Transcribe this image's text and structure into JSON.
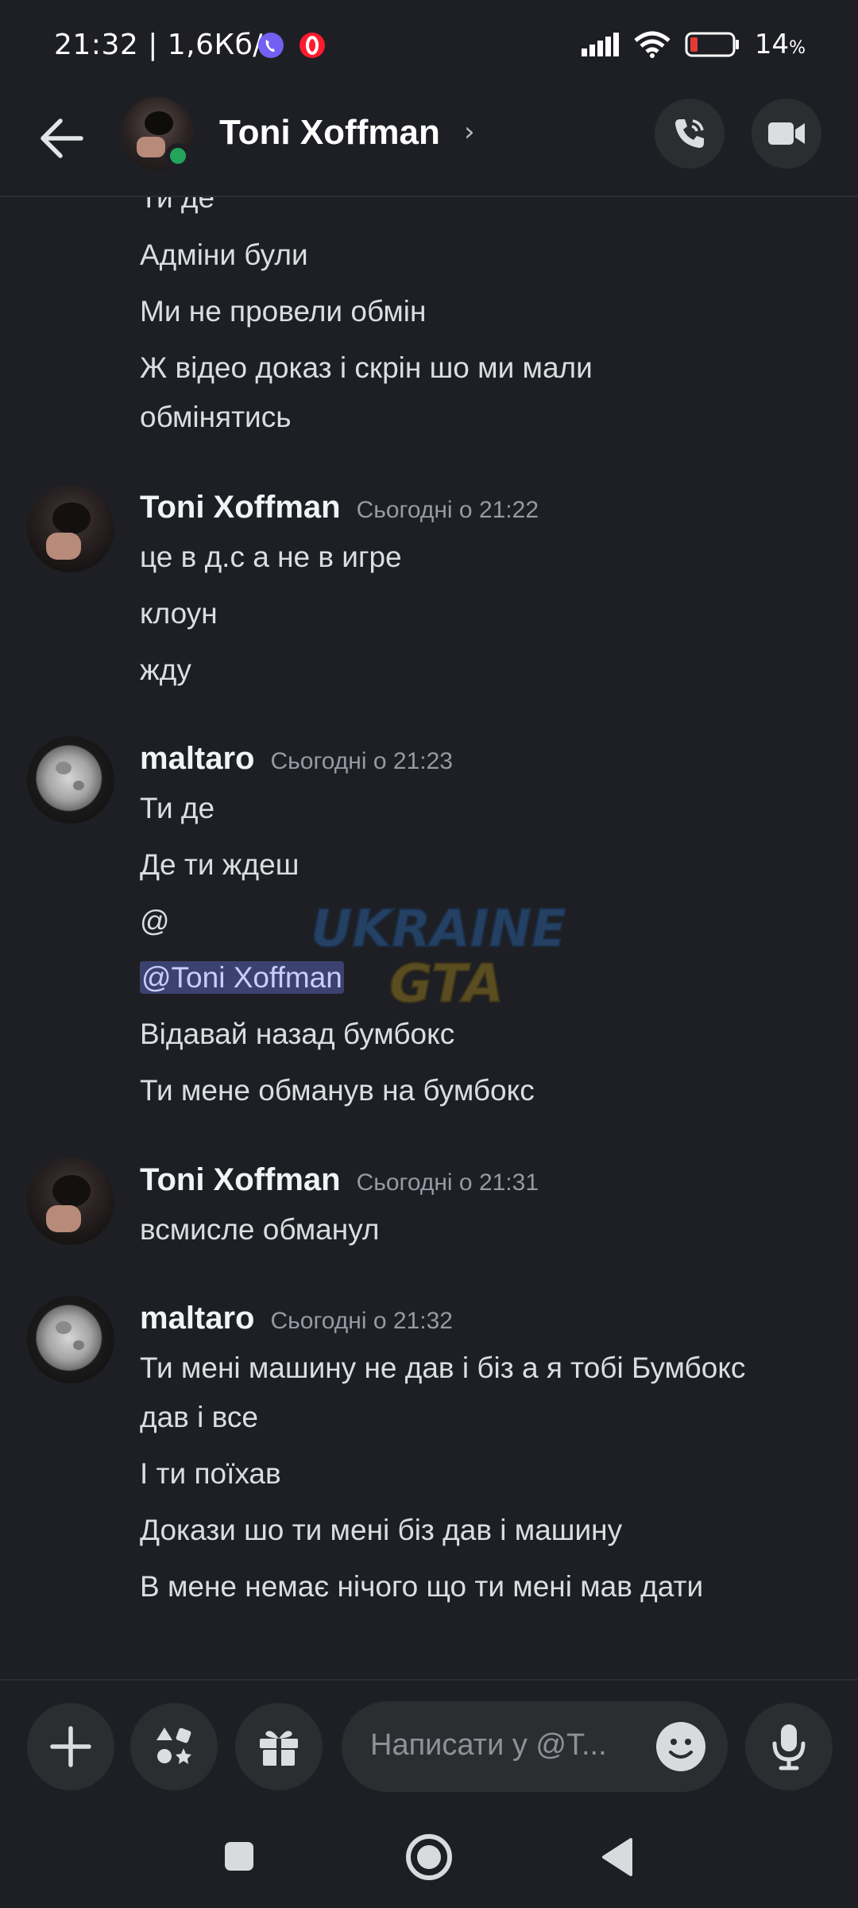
{
  "status_bar": {
    "time": "21:32",
    "network_speed": "| 1,6Кб/с",
    "battery_percent": "14",
    "battery_unit": "%",
    "icons": [
      "viber-icon",
      "opera-icon",
      "signal-icon",
      "wifi-icon",
      "battery-low-icon"
    ]
  },
  "header": {
    "title": "Toni Xoffman",
    "chevron": "›",
    "online": true
  },
  "messages": {
    "top_block": {
      "lines": [
        "Ти де",
        "Адміни були",
        "Ми не провели обмін",
        "Ж відео доказ і скрін шо ми мали",
        "обмінятись"
      ]
    },
    "group1": {
      "author": "Toni Xoffman",
      "timestamp": "Сьогодні о 21:22",
      "lines": [
        "це в д.с а не в игре",
        "клоун",
        "жду"
      ]
    },
    "group2": {
      "author": "maltaro",
      "timestamp": "Сьогодні о 21:23",
      "lines": [
        "Ти де",
        "Де ти ждеш",
        "@",
        "@Toni Xoffman",
        "Відавай назад бумбокс",
        "Ти мене обманув на бумбокс"
      ]
    },
    "group3": {
      "author": "Toni Xoffman",
      "timestamp": "Сьогодні о 21:31",
      "lines": [
        "всмисле обманул"
      ]
    },
    "group4": {
      "author": "maltaro",
      "timestamp": "Сьогодні о 21:32",
      "lines": [
        "Ти мені машину не дав і біз а я тобі Бумбокс",
        "дав і все",
        "І ти поїхав",
        "Докази шо ти мені біз дав і машину",
        "В мене немає нічого що ти мені мав дати"
      ]
    }
  },
  "watermark": {
    "line1": "UKRAINE",
    "line2": "GTA"
  },
  "composer": {
    "placeholder": "Написати у @T..."
  },
  "colors": {
    "background": "#1e1f24",
    "online": "#23a55a",
    "mention_bg": "#3c4270",
    "battery_low": "#e53935"
  }
}
